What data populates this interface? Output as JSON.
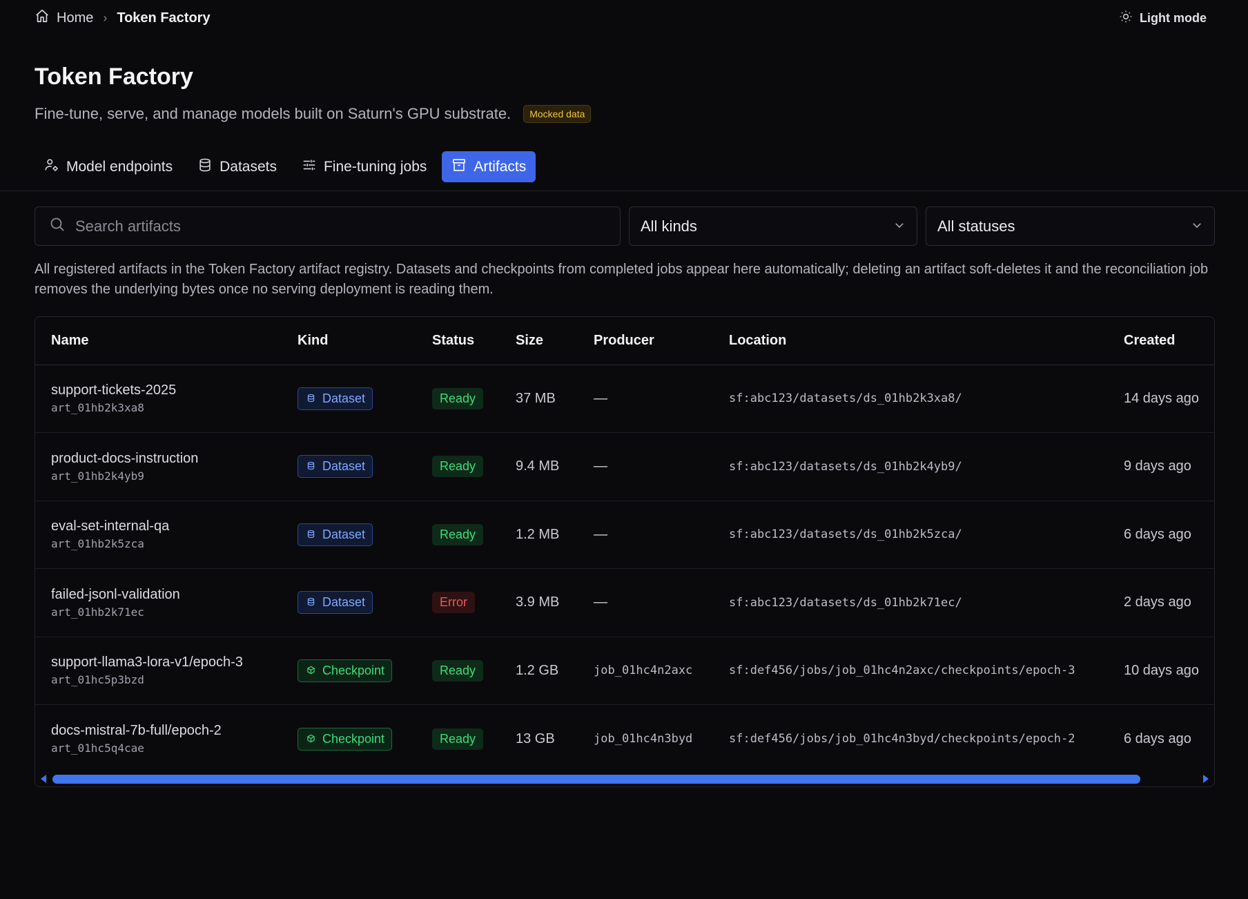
{
  "breadcrumb": {
    "home": "Home",
    "separator": "›",
    "current": "Token Factory"
  },
  "theme_toggle": {
    "label": "Light mode"
  },
  "header": {
    "title": "Token Factory",
    "subtitle": "Fine-tune, serve, and manage models built on Saturn's GPU substrate.",
    "badge": "Mocked data"
  },
  "tabs": [
    {
      "label": "Model endpoints",
      "icon": "user-gear-icon"
    },
    {
      "label": "Datasets",
      "icon": "database-icon"
    },
    {
      "label": "Fine-tuning jobs",
      "icon": "sliders-icon"
    },
    {
      "label": "Artifacts",
      "icon": "archive-icon",
      "active": true
    }
  ],
  "filters": {
    "search_placeholder": "Search artifacts",
    "kind_selected": "All kinds",
    "status_selected": "All statuses"
  },
  "description": "All registered artifacts in the Token Factory artifact registry. Datasets and checkpoints from completed jobs appear here automatically; deleting an artifact soft-deletes it and the reconciliation job removes the underlying bytes once no serving deployment is reading them.",
  "table": {
    "columns": [
      "Name",
      "Kind",
      "Status",
      "Size",
      "Producer",
      "Location",
      "Created"
    ],
    "rows": [
      {
        "name": "support-tickets-2025",
        "id": "art_01hb2k3xa8",
        "kind": "Dataset",
        "status": "Ready",
        "size": "37 MB",
        "producer": "—",
        "location": "sf:abc123/datasets/ds_01hb2k3xa8/",
        "created": "14 days ago"
      },
      {
        "name": "product-docs-instruction",
        "id": "art_01hb2k4yb9",
        "kind": "Dataset",
        "status": "Ready",
        "size": "9.4 MB",
        "producer": "—",
        "location": "sf:abc123/datasets/ds_01hb2k4yb9/",
        "created": "9 days ago"
      },
      {
        "name": "eval-set-internal-qa",
        "id": "art_01hb2k5zca",
        "kind": "Dataset",
        "status": "Ready",
        "size": "1.2 MB",
        "producer": "—",
        "location": "sf:abc123/datasets/ds_01hb2k5zca/",
        "created": "6 days ago"
      },
      {
        "name": "failed-jsonl-validation",
        "id": "art_01hb2k71ec",
        "kind": "Dataset",
        "status": "Error",
        "size": "3.9 MB",
        "producer": "—",
        "location": "sf:abc123/datasets/ds_01hb2k71ec/",
        "created": "2 days ago"
      },
      {
        "name": "support-llama3-lora-v1/epoch-3",
        "id": "art_01hc5p3bzd",
        "kind": "Checkpoint",
        "status": "Ready",
        "size": "1.2 GB",
        "producer": "job_01hc4n2axc",
        "location": "sf:def456/jobs/job_01hc4n2axc/checkpoints/epoch-3",
        "created": "10 days ago"
      },
      {
        "name": "docs-mistral-7b-full/epoch-2",
        "id": "art_01hc5q4cae",
        "kind": "Checkpoint",
        "status": "Ready",
        "size": "13 GB",
        "producer": "job_01hc4n3byd",
        "location": "sf:def456/jobs/job_01hc4n3byd/checkpoints/epoch-2",
        "created": "6 days ago"
      }
    ]
  },
  "colors": {
    "background": "#0a0a0d",
    "accent": "#3f66e8",
    "ready": "#3ddc7a",
    "error": "#f0575a",
    "dataset": "#7ea8ff",
    "mock_badge": "#f2c53d"
  }
}
